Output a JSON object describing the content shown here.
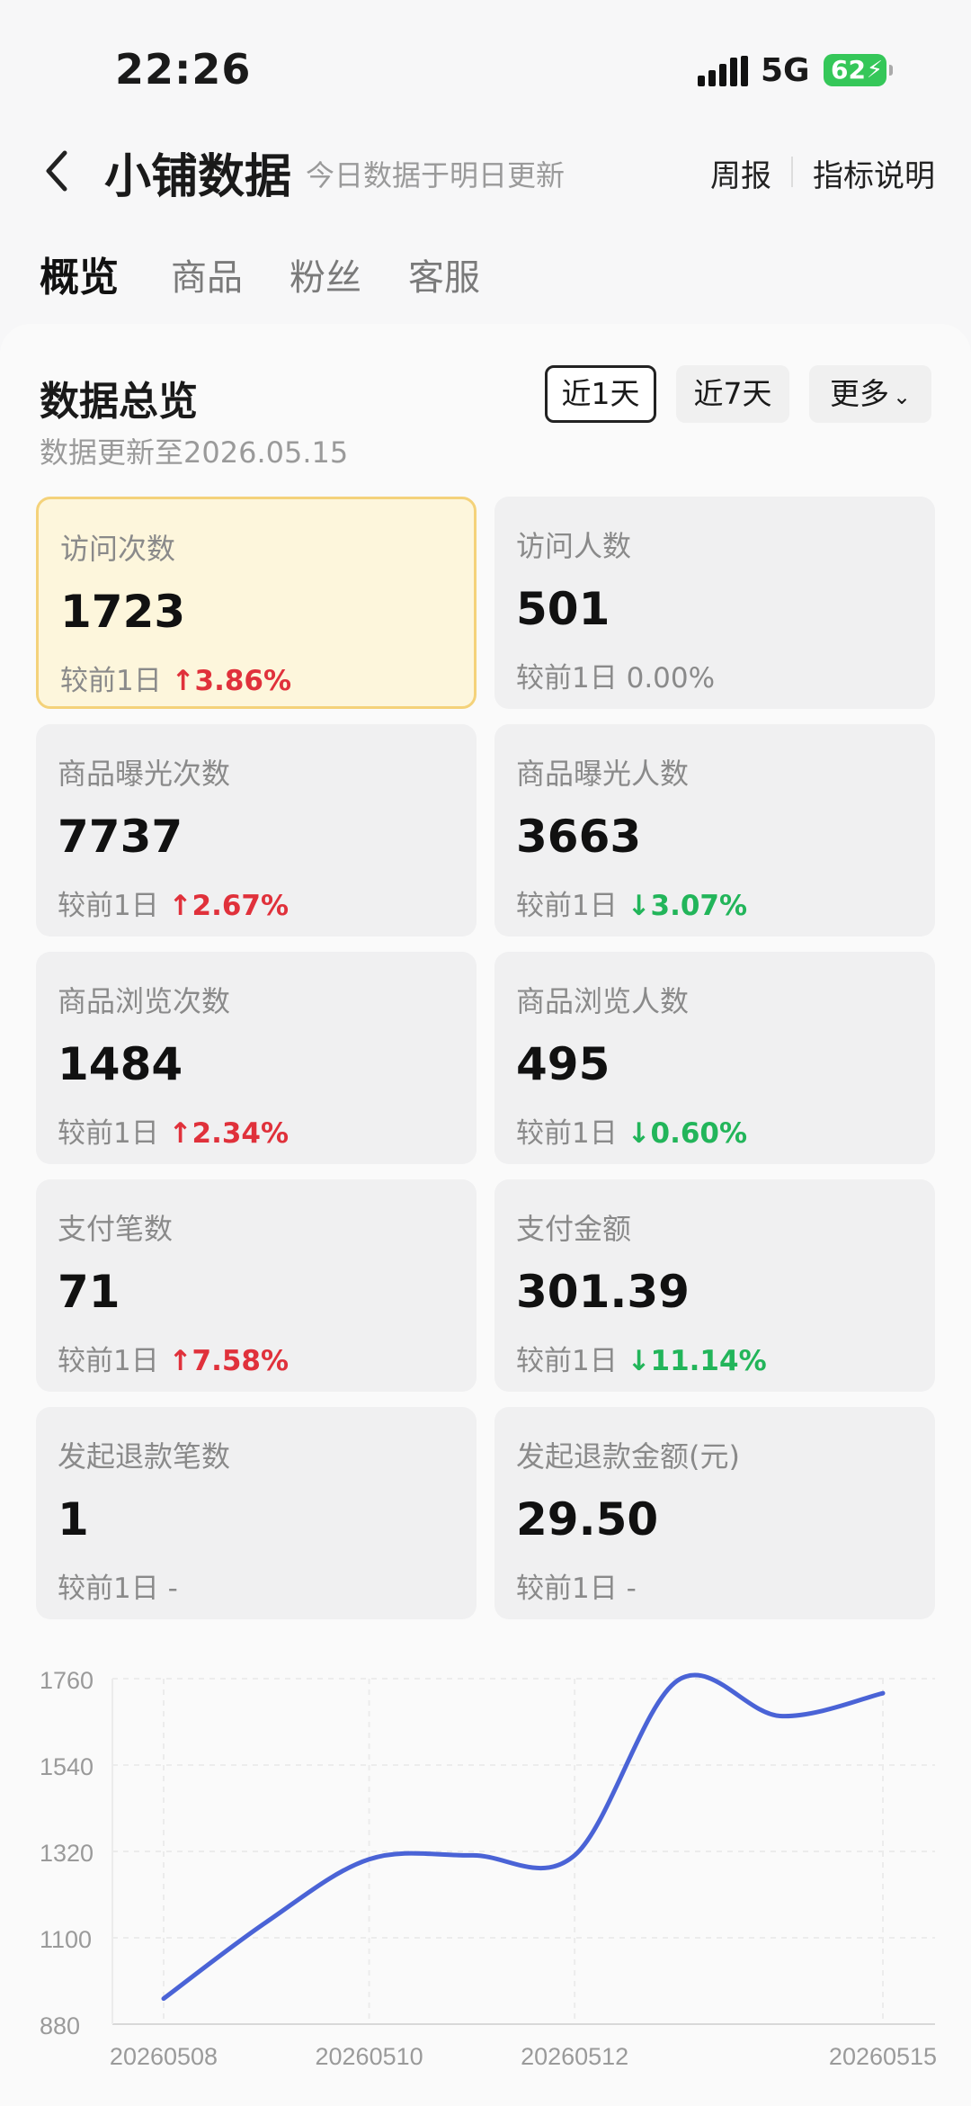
{
  "status": {
    "time": "22:26",
    "network": "5G",
    "battery": "62"
  },
  "header": {
    "title": "小铺数据",
    "subtitle": "今日数据于明日更新",
    "weekly_report": "周报",
    "metric_help": "指标说明"
  },
  "tabs": [
    {
      "label": "概览"
    },
    {
      "label": "商品"
    },
    {
      "label": "粉丝"
    },
    {
      "label": "客服"
    }
  ],
  "overview": {
    "title": "数据总览",
    "updated": "数据更新至2026.05.15",
    "range_options": {
      "day1": "近1天",
      "day7": "近7天",
      "more": "更多"
    },
    "compare_prefix": "较前1日",
    "metrics": [
      {
        "label": "访问次数",
        "value": "1723",
        "change": "3.86%",
        "dir": "up"
      },
      {
        "label": "访问人数",
        "value": "501",
        "change": "0.00%",
        "dir": "flat"
      },
      {
        "label": "商品曝光次数",
        "value": "7737",
        "change": "2.67%",
        "dir": "up"
      },
      {
        "label": "商品曝光人数",
        "value": "3663",
        "change": "3.07%",
        "dir": "down"
      },
      {
        "label": "商品浏览次数",
        "value": "1484",
        "change": "2.34%",
        "dir": "up"
      },
      {
        "label": "商品浏览人数",
        "value": "495",
        "change": "0.60%",
        "dir": "down"
      },
      {
        "label": "支付笔数",
        "value": "71",
        "change": "7.58%",
        "dir": "up"
      },
      {
        "label": "支付金额",
        "value": "301.39",
        "change": "11.14%",
        "dir": "down"
      },
      {
        "label": "发起退款笔数",
        "value": "1",
        "change": "-",
        "dir": "none"
      },
      {
        "label": "发起退款金额(元)",
        "value": "29.50",
        "change": "-",
        "dir": "none"
      }
    ]
  },
  "chart_data": {
    "type": "line",
    "x": [
      "20260508",
      "20260509",
      "20260510",
      "20260511",
      "20260512",
      "20260513",
      "20260514",
      "20260515"
    ],
    "x_tick_labels": [
      "20260508",
      "20260510",
      "20260512",
      "20260515"
    ],
    "values": [
      945,
      1140,
      1300,
      1310,
      1310,
      1755,
      1665,
      1723
    ],
    "y_ticks": [
      880,
      1100,
      1320,
      1540,
      1760
    ],
    "ylim": [
      880,
      1760
    ],
    "grid": true,
    "line_color": "#4a63d6"
  }
}
